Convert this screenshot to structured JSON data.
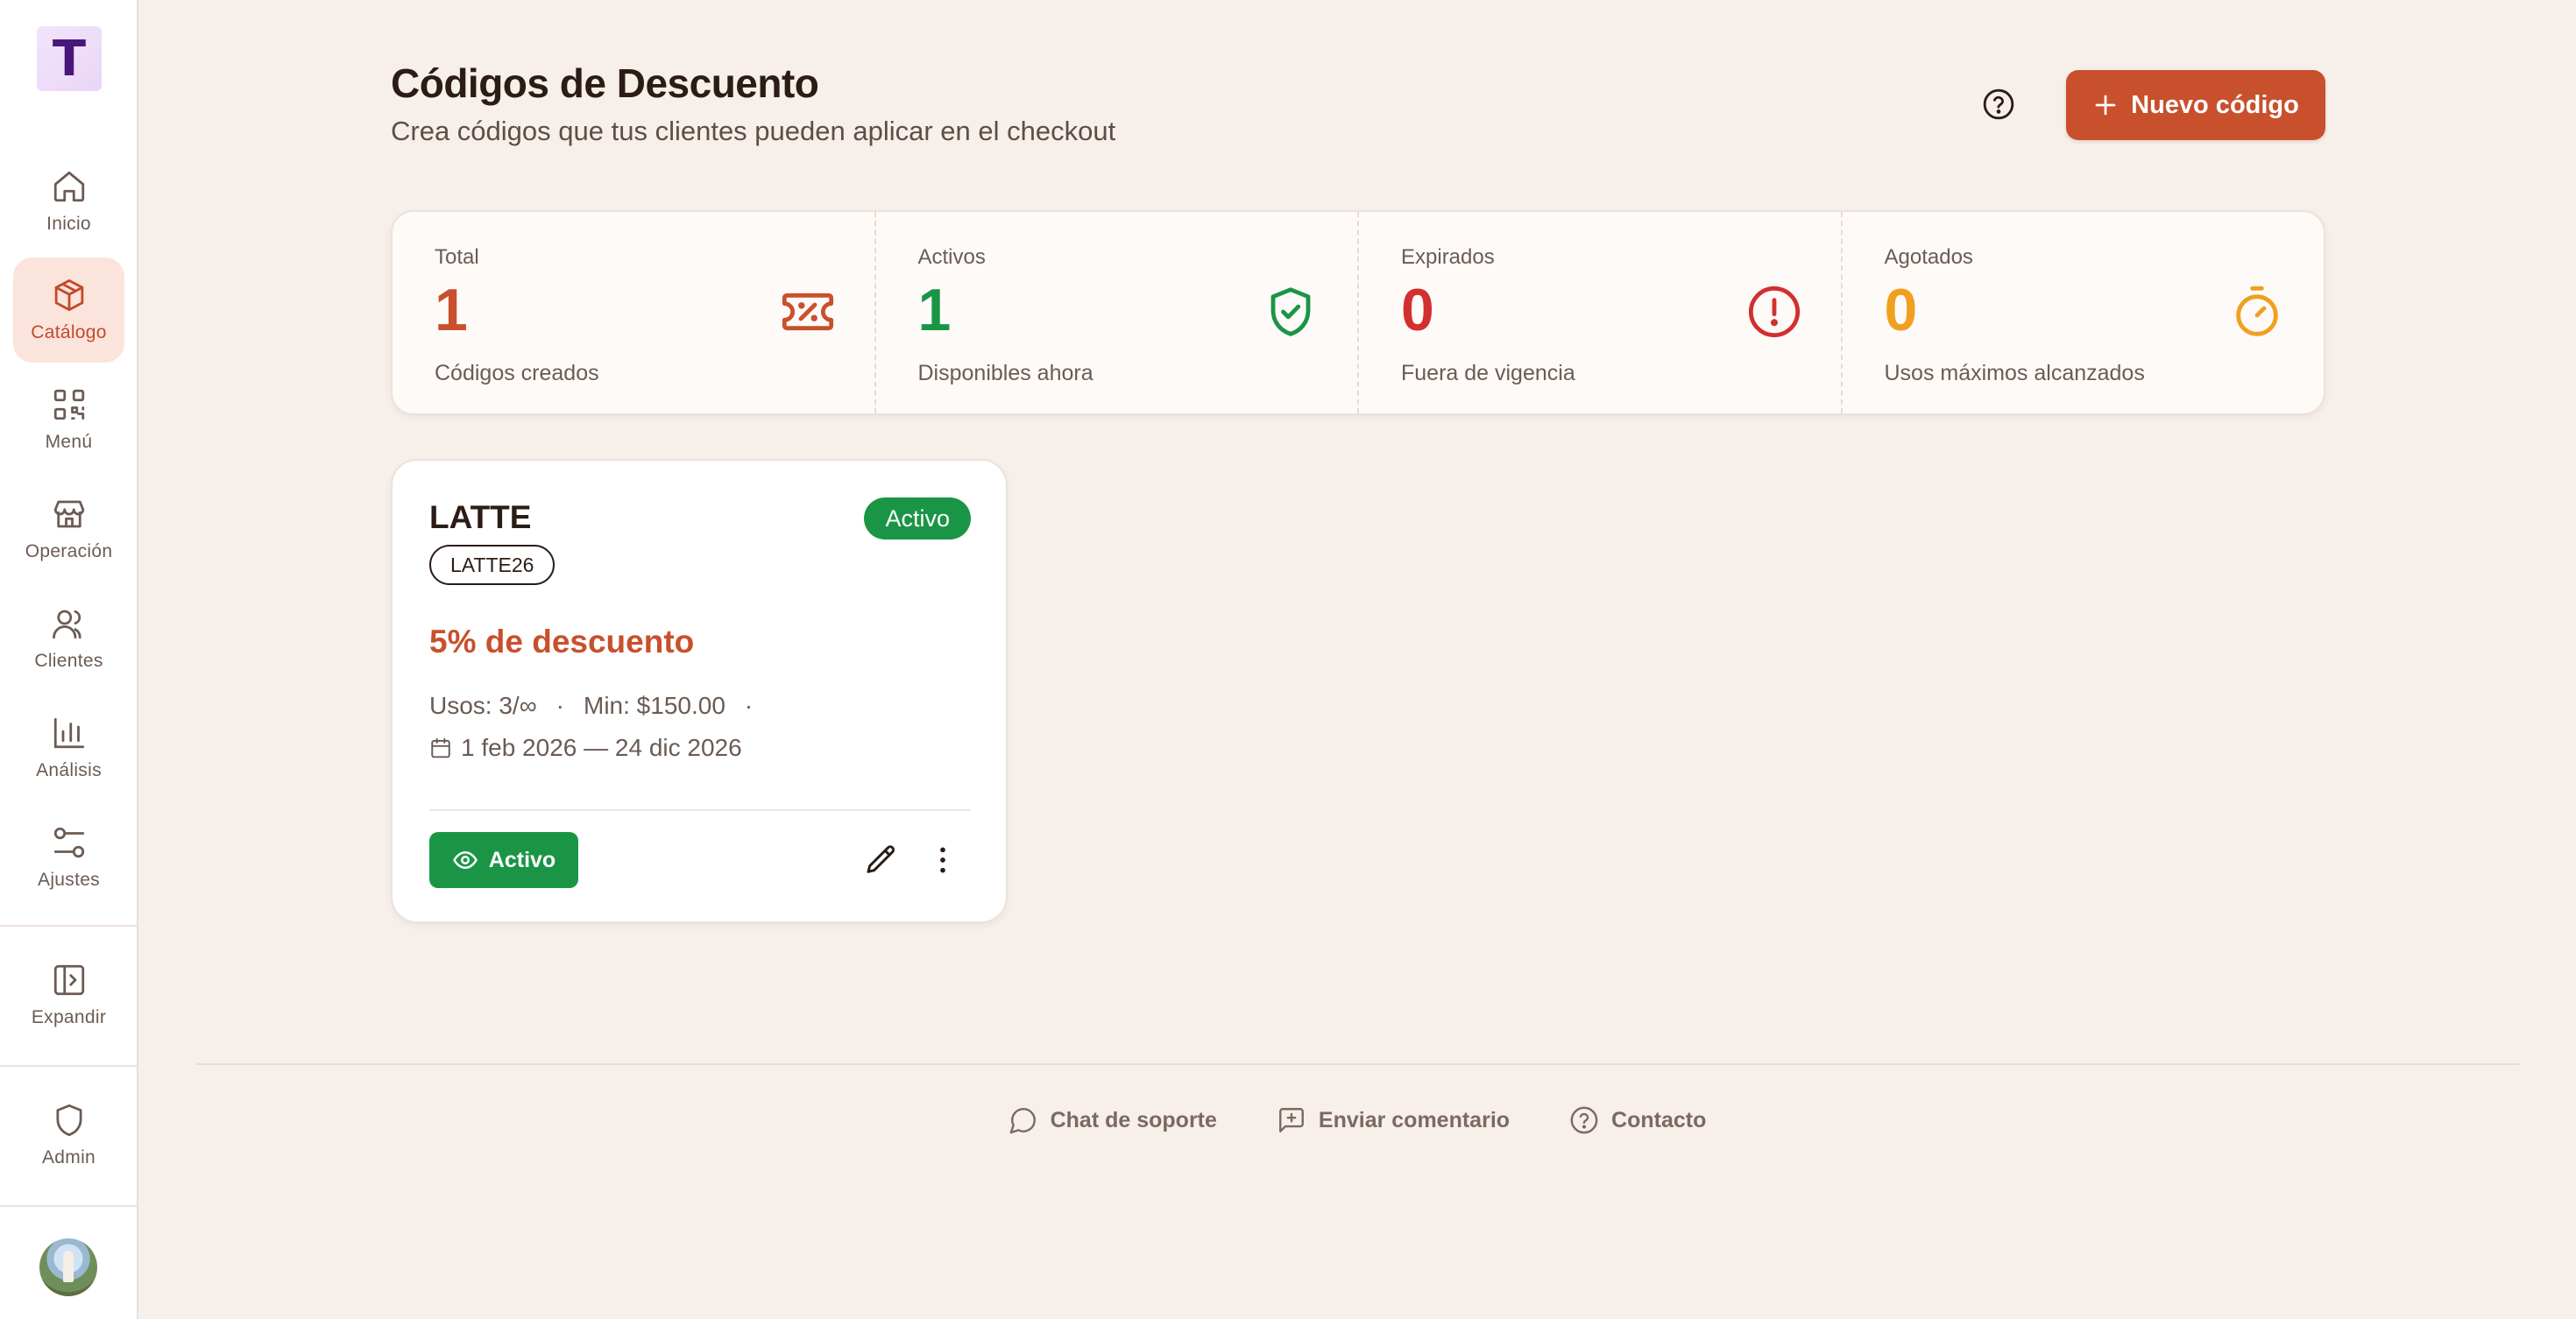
{
  "sidebar": {
    "logo_letter": "T",
    "items": [
      {
        "label": "Inicio",
        "icon": "home-icon"
      },
      {
        "label": "Catálogo",
        "icon": "box-icon",
        "active": true
      },
      {
        "label": "Menú",
        "icon": "qr-code-icon"
      },
      {
        "label": "Operación",
        "icon": "store-icon"
      },
      {
        "label": "Clientes",
        "icon": "users-icon"
      },
      {
        "label": "Análisis",
        "icon": "bar-chart-icon"
      },
      {
        "label": "Ajustes",
        "icon": "sliders-icon"
      }
    ],
    "expand_label": "Expandir",
    "admin_label": "Admin"
  },
  "header": {
    "title": "Códigos de Descuento",
    "subtitle": "Crea códigos que tus clientes pueden aplicar en el checkout",
    "new_button_label": "Nuevo código"
  },
  "stats": [
    {
      "label": "Total",
      "value": "1",
      "sub": "Códigos creados",
      "color": "#c8502c",
      "icon": "ticket-percent-icon"
    },
    {
      "label": "Activos",
      "value": "1",
      "sub": "Disponibles ahora",
      "color": "#1a9546",
      "icon": "shield-check-icon"
    },
    {
      "label": "Expirados",
      "value": "0",
      "sub": "Fuera de vigencia",
      "color": "#d32f2f",
      "icon": "alert-circle-icon"
    },
    {
      "label": "Agotados",
      "value": "0",
      "sub": "Usos máximos alcanzados",
      "color": "#f0a020",
      "icon": "timer-icon"
    }
  ],
  "card": {
    "name": "LATTE",
    "code": "LATTE26",
    "status": "Activo",
    "discount": "5% de descuento",
    "uses": "Usos: 3/∞",
    "sep": "·",
    "min": "Min: $150.00",
    "dates": "1 feb 2026 — 24 dic 2026",
    "toggle_label": "Activo"
  },
  "footer": {
    "support": "Chat de soporte",
    "feedback": "Enviar comentario",
    "contact": "Contacto"
  }
}
